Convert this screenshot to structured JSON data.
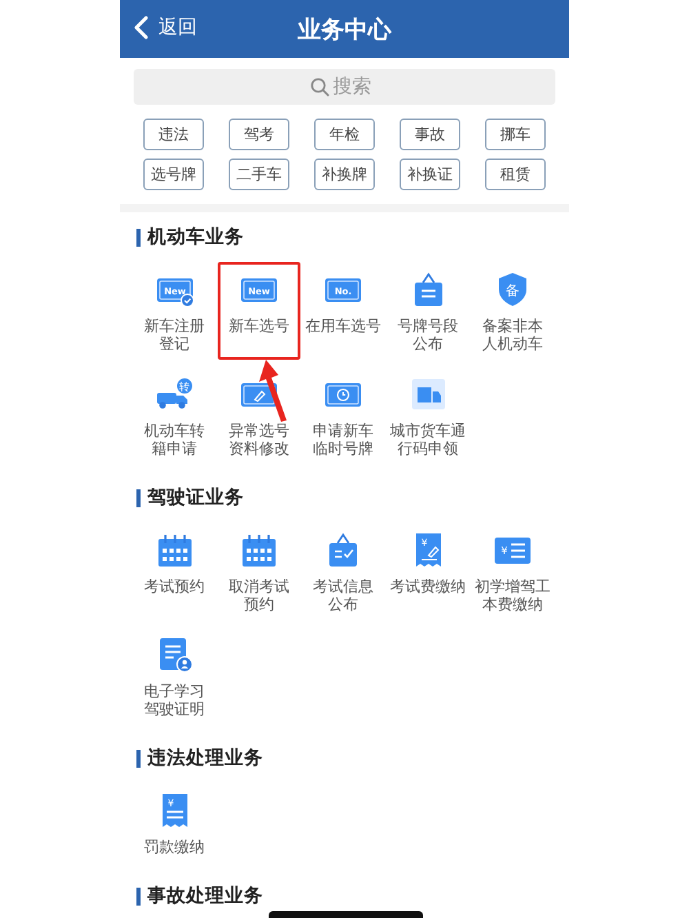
{
  "header": {
    "back": "返回",
    "title": "业务中心"
  },
  "search": {
    "placeholder": "搜索"
  },
  "tags": [
    "违法",
    "驾考",
    "年检",
    "事故",
    "挪车",
    "选号牌",
    "二手车",
    "补换牌",
    "补换证",
    "租赁"
  ],
  "sections": [
    {
      "title": "机动车业务",
      "items": [
        {
          "lines": [
            "新车注册",
            "登记"
          ],
          "kind": "plate-check",
          "badge": "New",
          "highlighted": false
        },
        {
          "lines": [
            "新车选号"
          ],
          "kind": "plate",
          "badge": "New",
          "highlighted": true
        },
        {
          "lines": [
            "在用车选号"
          ],
          "kind": "plate",
          "badge": "No.",
          "highlighted": false
        },
        {
          "lines": [
            "号牌号段",
            "公布"
          ],
          "kind": "signboard",
          "highlighted": false
        },
        {
          "lines": [
            "备案非本",
            "人机动车"
          ],
          "kind": "shield",
          "badge": "备",
          "highlighted": false
        },
        {
          "lines": [
            "机动车转",
            "籍申请"
          ],
          "kind": "truck",
          "badge": "转",
          "highlighted": false
        },
        {
          "lines": [
            "异常选号",
            "资料修改"
          ],
          "kind": "plate-edit",
          "highlighted": false
        },
        {
          "lines": [
            "申请新车",
            "临时号牌"
          ],
          "kind": "plate-clock",
          "highlighted": false
        },
        {
          "lines": [
            "城市货车通",
            "行码申领"
          ],
          "kind": "van",
          "highlighted": false
        }
      ]
    },
    {
      "title": "驾驶证业务",
      "items": [
        {
          "lines": [
            "考试预约"
          ],
          "kind": "calendar",
          "highlighted": false
        },
        {
          "lines": [
            "取消考试",
            "预约"
          ],
          "kind": "calendar",
          "highlighted": false
        },
        {
          "lines": [
            "考试信息",
            "公布"
          ],
          "kind": "sign-check",
          "highlighted": false
        },
        {
          "lines": [
            "考试费缴纳"
          ],
          "kind": "receipt-pen",
          "badge": "¥",
          "highlighted": false
        },
        {
          "lines": [
            "初学增驾工",
            "本费缴纳"
          ],
          "kind": "card",
          "badge": "¥",
          "highlighted": false
        },
        {
          "lines": [
            "电子学习",
            "驾驶证明"
          ],
          "kind": "doc-person",
          "highlighted": false
        }
      ]
    },
    {
      "title": "违法处理业务",
      "items": [
        {
          "lines": [
            "罚款缴纳"
          ],
          "kind": "receipt",
          "badge": "¥",
          "highlighted": false
        }
      ]
    },
    {
      "title": "事故处理业务"
    }
  ]
}
